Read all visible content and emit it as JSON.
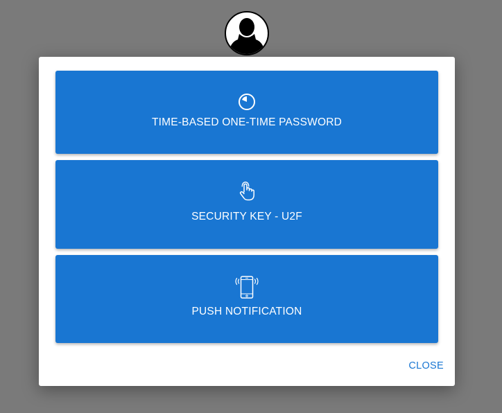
{
  "dialog": {
    "methods": [
      {
        "label": "TIME-BASED ONE-TIME PASSWORD",
        "icon": "timer-icon"
      },
      {
        "label": "SECURITY KEY - U2F",
        "icon": "touch-hand-icon"
      },
      {
        "label": "PUSH NOTIFICATION",
        "icon": "vibrating-phone-icon"
      }
    ],
    "close_label": "CLOSE"
  },
  "user": {
    "avatar_icon": "user-avatar-icon"
  },
  "colors": {
    "backdrop": "#7a7a7a",
    "accent": "#1976d2",
    "dialog_bg": "#ffffff"
  }
}
